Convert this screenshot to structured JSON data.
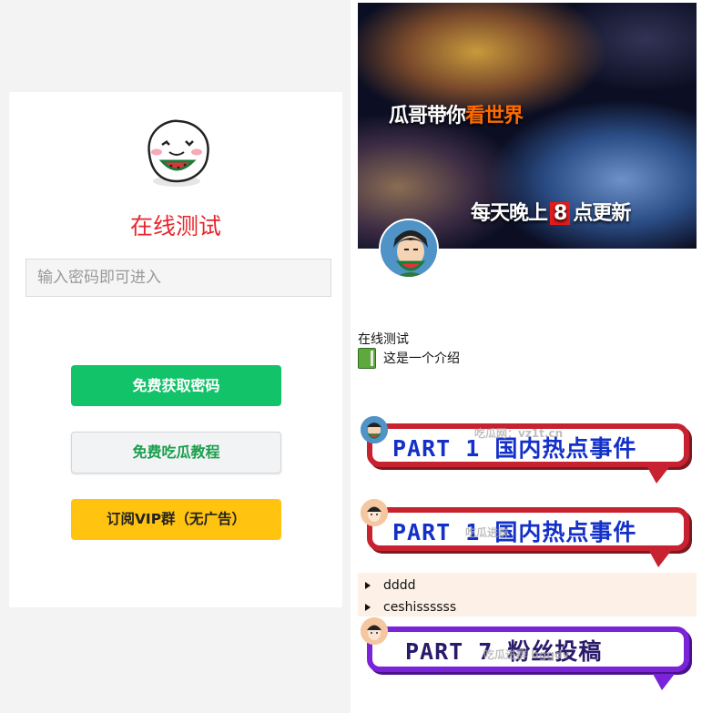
{
  "login": {
    "title": "在线测试",
    "password_placeholder": "输入密码即可进入",
    "password_value": "",
    "buttons": {
      "get_password": "免费获取密码",
      "tutorial": "免费吃瓜教程",
      "vip": "订阅VIP群（无广告）"
    }
  },
  "profile": {
    "banner": {
      "line1_prefix": "瓜哥带你",
      "line1_highlight": "看世界",
      "line2_prefix": "每天晚上",
      "line2_number": "8",
      "line2_suffix": "点更新"
    },
    "name": "在线测试",
    "intro": "这是一个介绍"
  },
  "parts": [
    {
      "text": "PART 1  国内热点事件",
      "watermark": "吃瓜网：vz1t.cn",
      "color": "#c8212f"
    },
    {
      "text": "PART 1  国内热点事件",
      "watermark": "吃瓜进群",
      "color": "#c8212f"
    },
    {
      "text": "PART 7  粉丝投稿",
      "watermark": "吃瓜进群 bggdv",
      "color": "#7a23d8"
    }
  ],
  "details": [
    "dddd",
    "ceshissssss"
  ]
}
